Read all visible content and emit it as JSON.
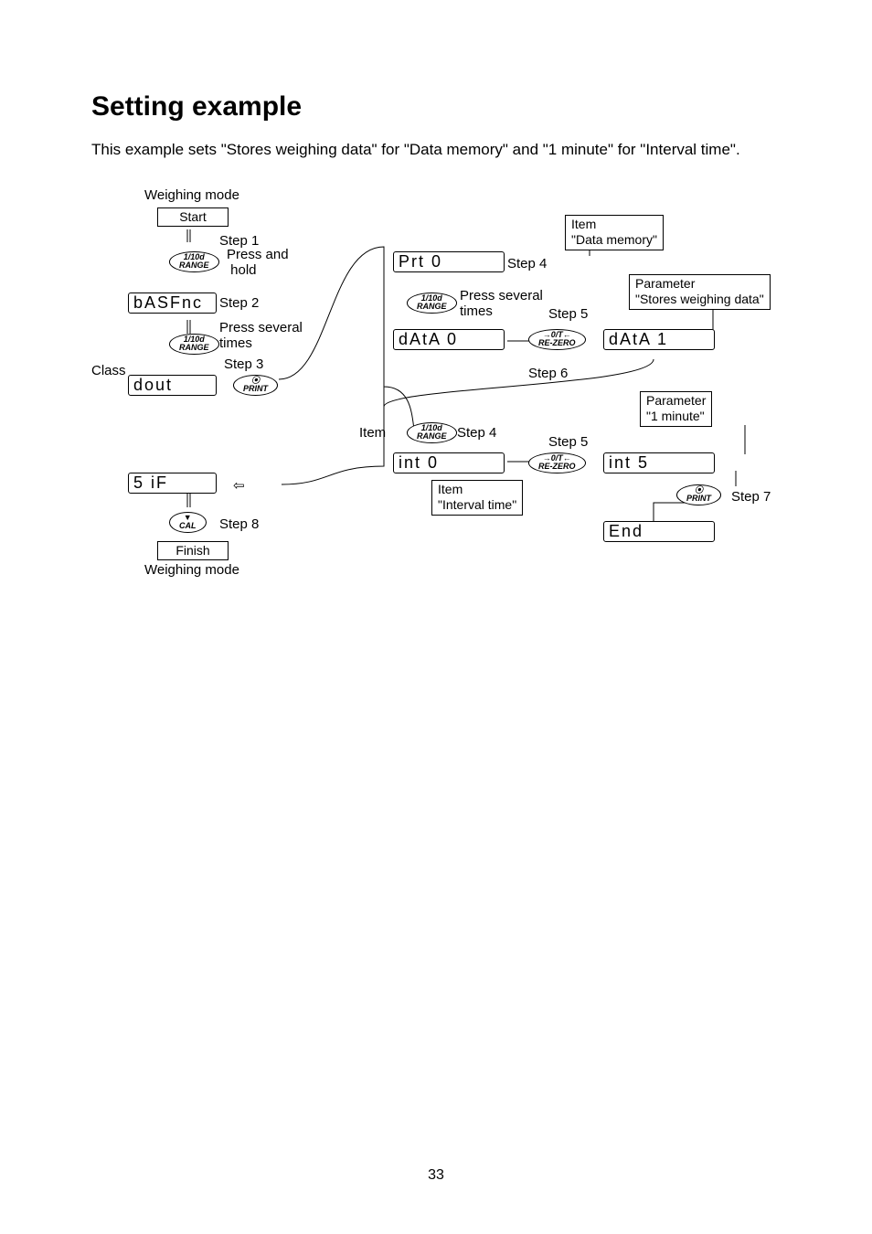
{
  "page": {
    "number": "33"
  },
  "heading": "Setting example",
  "intro": "This example sets \"Stores weighing data\" for \"Data memory\" and \"1 minute\" for \"Interval time\".",
  "labels": {
    "weighing_mode_top": "Weighing mode",
    "weighing_mode_bottom": "Weighing mode",
    "start": "Start",
    "finish": "Finish",
    "class": "Class",
    "item": "Item",
    "step1": "Step 1",
    "step2": "Step 2",
    "step3": "Step 3",
    "step4": "Step 4",
    "step5": "Step 5",
    "step6": "Step 6",
    "step7": "Step 7",
    "step8": "Step 8",
    "press_hold": "Press and\n hold",
    "press_several": "Press several\ntimes",
    "press_several2": "Press several\ntimes"
  },
  "buttons": {
    "range": "1/10d\nRANGE",
    "print": "PRINT",
    "rezero": "→0/T←\nRE-ZERO",
    "cal": "▼\nCAL"
  },
  "lcd": {
    "basfnc": "bASFnc",
    "dout": "dout",
    "sif": "5 iF",
    "prt": "Prt      0",
    "data0": "dAtA   0",
    "data1": "dAtA   1",
    "int0": " int      0",
    "int5": " int      5",
    "end": "End"
  },
  "callouts": {
    "data_memory": "Item\n\"Data memory\"",
    "stores": "Parameter\n\"Stores weighing data\"",
    "one_minute": "Parameter\n\"1 minute\"",
    "interval": "Item\n\"Interval time\""
  }
}
